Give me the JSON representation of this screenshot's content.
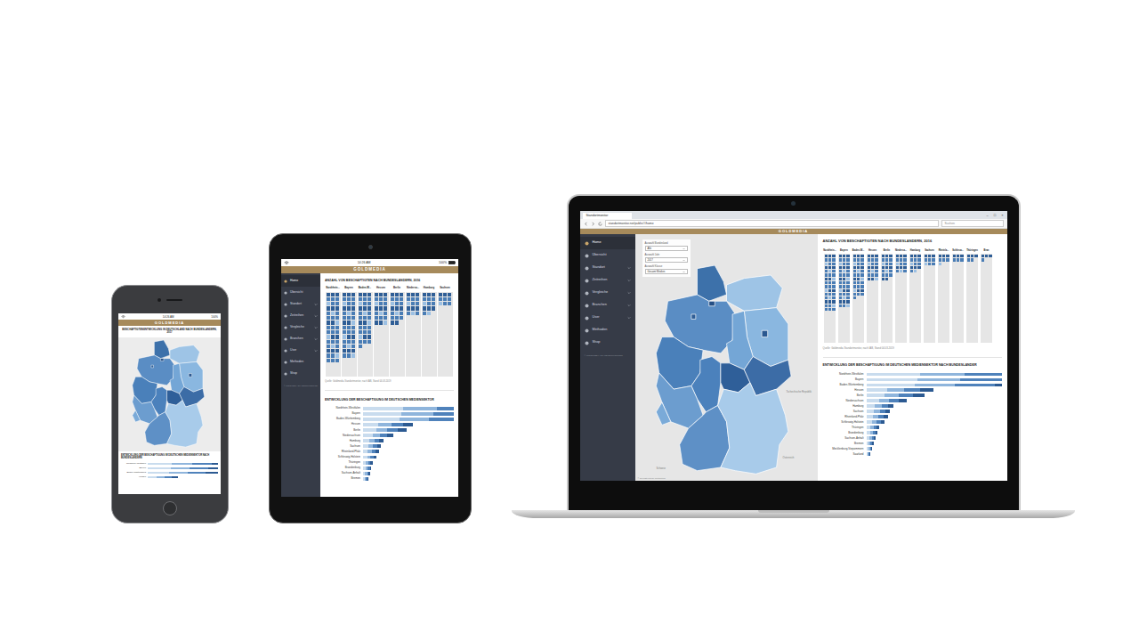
{
  "brand": "GOLDMEDIA",
  "browser": {
    "tab": "Standortmonitor",
    "url": "standortmonitor.net/public/#/home",
    "search": "Suchen",
    "window_controls": [
      "–",
      "□",
      "×"
    ]
  },
  "devices": {
    "phone": {
      "status": {
        "time": "14:26 AM",
        "battery": "100%"
      },
      "map_title": "BESCHÄFTIGTENENTWICKLUNG IN DEUTSCHLAND NACH BUNDESLÄNDERN, 2017",
      "bars_title": "ENTWICKLUNG DER BESCHÄFTIGUNG IM DEUTSCHEN MEDIENSEKTOR NACH BUNDESLÄNDERN"
    },
    "tablet": {
      "status": {
        "time": "14:26 AM",
        "battery": "100%"
      },
      "bars_title": "ENTWICKLUNG DER BESCHÄFTIGUNG IM DEUTSCHEN MEDIENSEKTOR"
    },
    "laptop": {
      "bars_title": "ENTWICKLUNG DER BESCHÄFTIGUNG IM DEUTSCHEN MEDIENSEKTOR NACH BUNDESLÄNDER"
    }
  },
  "sidebar": {
    "items": [
      {
        "label": "Home",
        "selected": true,
        "expandable": false
      },
      {
        "label": "Übersicht",
        "selected": false,
        "expandable": false
      },
      {
        "label": "Standort",
        "selected": false,
        "expandable": true
      },
      {
        "label": "Zeitreihen",
        "selected": false,
        "expandable": true
      },
      {
        "label": "Vergleiche",
        "selected": false,
        "expandable": true
      },
      {
        "label": "Branchen",
        "selected": false,
        "expandable": true
      },
      {
        "label": "User",
        "selected": false,
        "expandable": true
      },
      {
        "label": "Methoden",
        "selected": false,
        "expandable": false
      },
      {
        "label": "Shop",
        "selected": false,
        "expandable": false
      }
    ],
    "footer": "© GOLDMEDIA STANDORTMONITOR"
  },
  "filters": [
    {
      "label": "Auswahl Bundesland",
      "value": "Alle"
    },
    {
      "label": "Auswahl Jahr",
      "value": "2017"
    },
    {
      "label": "Auswahl Klasse",
      "value": "Gesamt Medien"
    }
  ],
  "map": {
    "regions": [
      {
        "color": "#3d71aa"
      },
      {
        "color": "#9ec4e6"
      },
      {
        "color": "#5a8dc4"
      },
      {
        "color": "#2e5d95"
      },
      {
        "color": "#254f85"
      },
      {
        "color": "#8ab7e0"
      },
      {
        "color": "#2a5890"
      },
      {
        "color": "#74a6d6"
      },
      {
        "color": "#4a80ba"
      },
      {
        "color": "#4b81bc"
      },
      {
        "color": "#2f5f99"
      },
      {
        "color": "#3c6ca6"
      },
      {
        "color": "#6c9dcf"
      },
      {
        "color": "#7aaad8"
      },
      {
        "color": "#5e90c6"
      },
      {
        "color": "#a8cbea"
      }
    ],
    "labels": [
      "Tschechische Republik",
      "Österreich",
      "Schweiz"
    ],
    "credit": "© OpenStreetMap contributors"
  },
  "waffle": {
    "title": "ANZAHL VON BESCHÄFTIGTEN NACH BUNDESLÄNDERN, 2016",
    "columns": [
      {
        "label": "Nordrhein...",
        "value": 45
      },
      {
        "label": "Bayern",
        "value": 42
      },
      {
        "label": "Baden-W...",
        "value": 34
      },
      {
        "label": "Hessen",
        "value": 21
      },
      {
        "label": "Berlin",
        "value": 20
      },
      {
        "label": "Niedersa...",
        "value": 15
      },
      {
        "label": "Hamburg",
        "value": 14
      },
      {
        "label": "Sachsen",
        "value": 9
      },
      {
        "label": "Rheinla...",
        "value": 7
      },
      {
        "label": "Schlesw...",
        "value": 6
      },
      {
        "label": "Thüringen",
        "value": 5
      },
      {
        "label": "Bran",
        "value": 4
      }
    ],
    "source": "Quelle: Goldmedia Standortmonitor, nach IAB, Stand 04.03.2019"
  },
  "bars": {
    "series": [
      {
        "color": "#c9dcee"
      },
      {
        "color": "#8fb5dc"
      },
      {
        "color": "#4f82bb"
      },
      {
        "color": "#2c5a92"
      }
    ],
    "rows": [
      {
        "label": "Nordrhein-Westfalen",
        "values": [
          60,
          50,
          50,
          40
        ]
      },
      {
        "label": "Bayern",
        "values": [
          57,
          48,
          47,
          38
        ]
      },
      {
        "label": "Baden-Württemberg",
        "values": [
          54,
          45,
          45,
          36
        ]
      },
      {
        "label": "Hessen",
        "values": [
          23,
          19,
          18,
          15
        ]
      },
      {
        "label": "Berlin",
        "values": [
          20,
          16,
          16,
          13
        ]
      },
      {
        "label": "Niedersachsen",
        "values": [
          14,
          11,
          11,
          9
        ]
      },
      {
        "label": "Hamburg",
        "values": [
          9,
          8,
          7,
          6
        ]
      },
      {
        "label": "Sachsen",
        "values": [
          8,
          7,
          6,
          5
        ]
      },
      {
        "label": "Rheinland-Pfalz",
        "values": [
          7,
          6,
          6,
          5
        ]
      },
      {
        "label": "Schleswig-Holstein",
        "values": [
          6,
          5,
          5,
          4
        ]
      },
      {
        "label": "Thüringen",
        "values": [
          4,
          4,
          3,
          3
        ]
      },
      {
        "label": "Brandenburg",
        "values": [
          4,
          3,
          3,
          2
        ]
      },
      {
        "label": "Sachsen-Anhalt",
        "values": [
          3,
          3,
          2,
          2
        ]
      },
      {
        "label": "Bremen",
        "values": [
          2,
          2,
          2,
          2
        ]
      },
      {
        "label": "Mecklenburg-Vorpommern",
        "values": [
          2,
          2,
          1,
          1
        ]
      },
      {
        "label": "Saarland",
        "values": [
          1,
          1,
          1,
          1
        ]
      }
    ]
  }
}
